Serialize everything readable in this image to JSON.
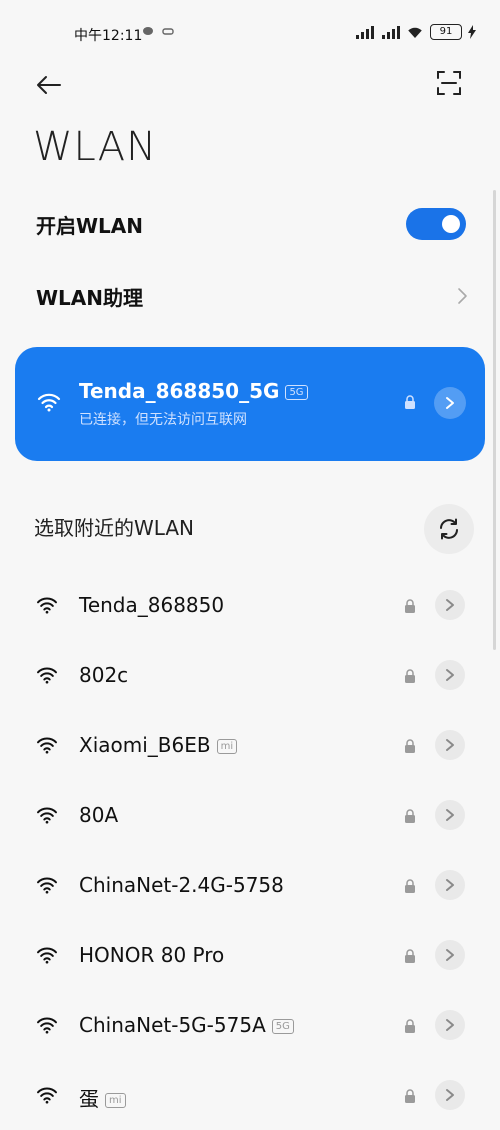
{
  "status": {
    "time": "中午12:11",
    "battery": "91"
  },
  "icons": {
    "back": "back-arrow-icon",
    "scan": "qr-scan-icon",
    "wifi": "wifi-icon",
    "lock": "lock-icon",
    "chevron": "chevron-right-icon",
    "refresh": "refresh-icon"
  },
  "colors": {
    "accent": "#1a7cf0",
    "background": "#f7f7f7"
  },
  "page": {
    "title": "WLAN"
  },
  "toggle": {
    "label": "开启WLAN",
    "state": "on"
  },
  "assistant": {
    "label": "WLAN助理"
  },
  "connected": {
    "name": "Tenda_868850_5G",
    "badge": "5G",
    "status": "已连接，但无法访问互联网"
  },
  "nearby": {
    "title": "选取附近的WLAN",
    "networks": [
      {
        "name": "Tenda_868850",
        "badge": ""
      },
      {
        "name": "802c",
        "badge": ""
      },
      {
        "name": "Xiaomi_B6EB",
        "badge": "mi"
      },
      {
        "name": "80A",
        "badge": ""
      },
      {
        "name": "ChinaNet-2.4G-5758",
        "badge": ""
      },
      {
        "name": "HONOR 80 Pro",
        "badge": ""
      },
      {
        "name": "ChinaNet-5G-575A",
        "badge": "5G"
      },
      {
        "name": "蛋",
        "badge": "mi"
      }
    ]
  }
}
